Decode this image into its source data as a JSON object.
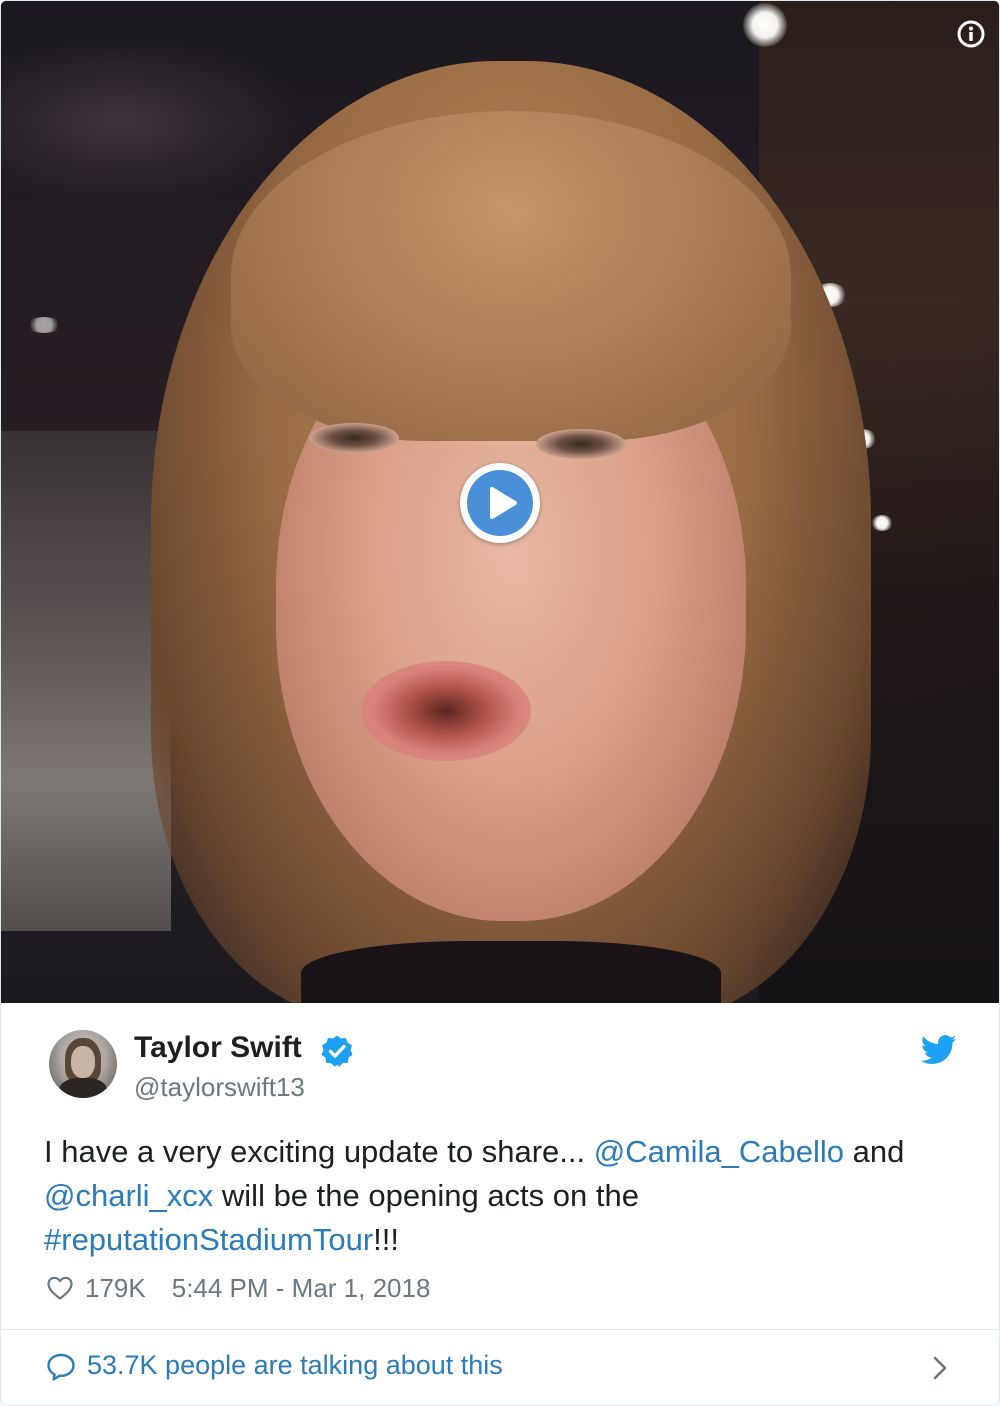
{
  "media": {
    "type": "video",
    "play_icon": "play-icon",
    "info_icon": "info-icon"
  },
  "author": {
    "display_name": "Taylor Swift",
    "handle": "@taylorswift13",
    "verified": true,
    "verified_icon": "verified-badge-icon",
    "avatar_icon": "avatar"
  },
  "brand": {
    "icon": "twitter-bird-icon",
    "color": "#1da1f2"
  },
  "tweet": {
    "text_part1": "I have a very exciting update to share... ",
    "mention1": "@Camila_Cabello",
    "text_part2": " and ",
    "mention2": "@charli_xcx",
    "text_part3": " will be the opening acts on the ",
    "hashtag": "#reputationStadiumTour",
    "text_part4": "!!!"
  },
  "meta": {
    "heart_icon": "heart-icon",
    "likes": "179K",
    "timestamp": "5:44 PM - Mar 1, 2018"
  },
  "conversation": {
    "icon": "speech-bubble-icon",
    "label": "53.7K people are talking about this",
    "chevron_icon": "chevron-right-icon"
  },
  "colors": {
    "text": "#1c2022",
    "secondary": "#697882",
    "link": "#2b7bb9",
    "play_button": "#4a90d9",
    "border": "#e1e8ed"
  }
}
